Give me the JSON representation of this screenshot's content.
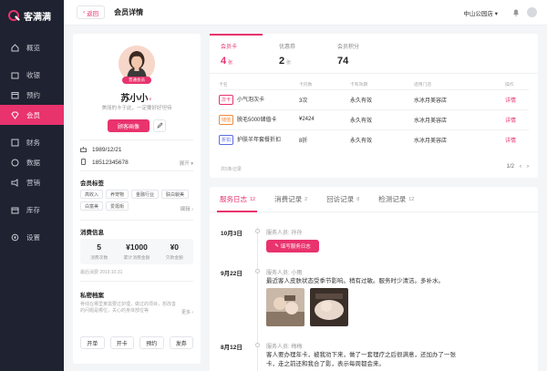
{
  "app": {
    "name": "客满满"
  },
  "sidebar": {
    "items": [
      {
        "label": "概览",
        "icon": "home-icon"
      },
      {
        "label": "收银",
        "icon": "cashier-icon"
      },
      {
        "label": "预约",
        "icon": "calendar-icon"
      },
      {
        "label": "会员",
        "icon": "member-icon",
        "active": true
      },
      {
        "label": "财务",
        "icon": "finance-icon"
      },
      {
        "label": "数据",
        "icon": "data-icon"
      },
      {
        "label": "营销",
        "icon": "marketing-icon"
      },
      {
        "label": "库存",
        "icon": "inventory-icon"
      },
      {
        "label": "设置",
        "icon": "settings-icon"
      }
    ]
  },
  "topbar": {
    "back_label": "返回",
    "title": "会员详情",
    "store": "中山公园店 ▾"
  },
  "profile": {
    "badge": "普通会员",
    "name": "苏小小",
    "signature": "美丽的卡于此，一定要好好坦待",
    "primary_btn": "顾客画像",
    "birthday": "1989/12/21",
    "phone": "18512345678",
    "expand_label": "展开 ▾",
    "tags_title": "会员标签",
    "tags": [
      "高收入",
      "养宠物",
      "金融行业",
      "肤白貌美",
      "白富美",
      "爱逛街"
    ],
    "tags_edit": "编辑 ›",
    "consume_title": "消费信息",
    "stats": [
      {
        "value": "5",
        "label": "消费次数"
      },
      {
        "value": "¥1000",
        "label": "累计消费金额"
      },
      {
        "value": "¥0",
        "label": "欠款金额"
      }
    ],
    "last_consume": "最后消费 2019.10.31",
    "private_title": "私密档案",
    "private_text": "骨线在哪里某需要过护理，做过的项目，想改善的问题是哪位，关心的身体部位等",
    "private_more": "更多 ›",
    "actions": [
      "开单",
      "开卡",
      "预约",
      "发券"
    ]
  },
  "cards": {
    "tabs": [
      {
        "label": "会员卡",
        "value": "4",
        "unit": "张"
      },
      {
        "label": "优惠券",
        "value": "2",
        "unit": "张"
      },
      {
        "label": "会员积分",
        "value": "74",
        "unit": ""
      }
    ],
    "headers": [
      "卡名",
      "卡内数",
      "卡有效期",
      "适用门店",
      "操作"
    ],
    "rows": [
      {
        "type": "次卡",
        "name": "小气泡次卡",
        "count": "3次",
        "validity": "永久有效",
        "store": "水冰月美容店",
        "action": "详情"
      },
      {
        "type": "储值",
        "name": "脱毛5000储值卡",
        "count": "¥2424",
        "validity": "永久有效",
        "store": "水冰月美容店",
        "action": "详情"
      },
      {
        "type": "折扣",
        "name": "护肤半年套餐折扣",
        "count": "8折",
        "validity": "永久有效",
        "store": "水冰月美容店",
        "action": "详情"
      }
    ],
    "footer": "共5条记录",
    "page": "1/2"
  },
  "logs": {
    "tabs": [
      {
        "label": "服务日志",
        "count": "12"
      },
      {
        "label": "消费记录",
        "count": "2"
      },
      {
        "label": "回访记录",
        "count": "8"
      },
      {
        "label": "检测记录",
        "count": "12"
      }
    ],
    "entries": [
      {
        "date": "10月3日",
        "staff": "服务人员: 孙孙",
        "button": "填写服务日志"
      },
      {
        "date": "9月22日",
        "staff": "服务人员: 小雨",
        "content": "最近客人皮肤状态受季节影响。稍有过敏。服务时少清洁。多补水。"
      },
      {
        "date": "8月12日",
        "staff": "服务人员: 梅梅",
        "content": "客人要办理年卡，被我劝下来，做了一套理疗之后很满意，还加办了一张卡，走之前还和我合了影，表示每周都会来。"
      }
    ]
  },
  "colors": {
    "accent": "#e8336d",
    "sidebar": "#1f2230"
  }
}
